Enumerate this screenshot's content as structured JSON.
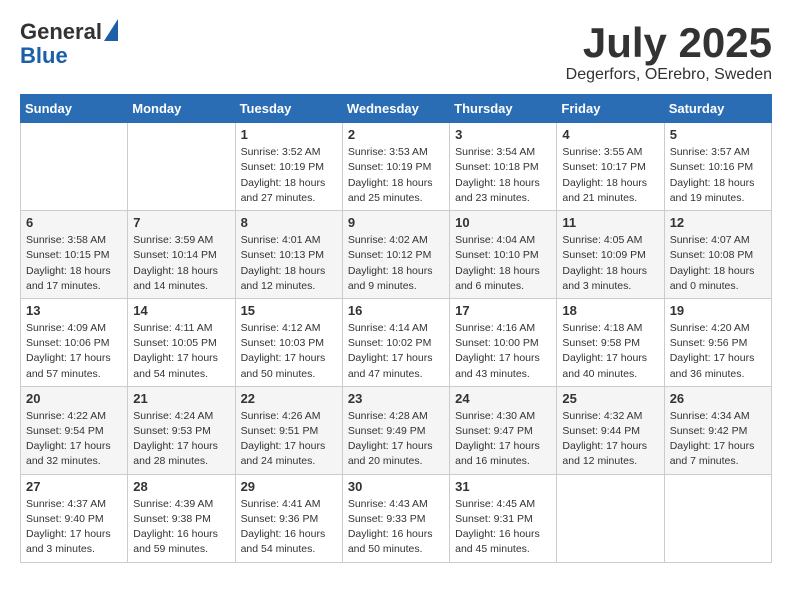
{
  "header": {
    "logo_line1": "General",
    "logo_line2": "Blue",
    "month_title": "July 2025",
    "location": "Degerfors, OErebro, Sweden"
  },
  "days_of_week": [
    "Sunday",
    "Monday",
    "Tuesday",
    "Wednesday",
    "Thursday",
    "Friday",
    "Saturday"
  ],
  "weeks": [
    [
      {
        "num": "",
        "info": ""
      },
      {
        "num": "",
        "info": ""
      },
      {
        "num": "1",
        "info": "Sunrise: 3:52 AM\nSunset: 10:19 PM\nDaylight: 18 hours and 27 minutes."
      },
      {
        "num": "2",
        "info": "Sunrise: 3:53 AM\nSunset: 10:19 PM\nDaylight: 18 hours and 25 minutes."
      },
      {
        "num": "3",
        "info": "Sunrise: 3:54 AM\nSunset: 10:18 PM\nDaylight: 18 hours and 23 minutes."
      },
      {
        "num": "4",
        "info": "Sunrise: 3:55 AM\nSunset: 10:17 PM\nDaylight: 18 hours and 21 minutes."
      },
      {
        "num": "5",
        "info": "Sunrise: 3:57 AM\nSunset: 10:16 PM\nDaylight: 18 hours and 19 minutes."
      }
    ],
    [
      {
        "num": "6",
        "info": "Sunrise: 3:58 AM\nSunset: 10:15 PM\nDaylight: 18 hours and 17 minutes."
      },
      {
        "num": "7",
        "info": "Sunrise: 3:59 AM\nSunset: 10:14 PM\nDaylight: 18 hours and 14 minutes."
      },
      {
        "num": "8",
        "info": "Sunrise: 4:01 AM\nSunset: 10:13 PM\nDaylight: 18 hours and 12 minutes."
      },
      {
        "num": "9",
        "info": "Sunrise: 4:02 AM\nSunset: 10:12 PM\nDaylight: 18 hours and 9 minutes."
      },
      {
        "num": "10",
        "info": "Sunrise: 4:04 AM\nSunset: 10:10 PM\nDaylight: 18 hours and 6 minutes."
      },
      {
        "num": "11",
        "info": "Sunrise: 4:05 AM\nSunset: 10:09 PM\nDaylight: 18 hours and 3 minutes."
      },
      {
        "num": "12",
        "info": "Sunrise: 4:07 AM\nSunset: 10:08 PM\nDaylight: 18 hours and 0 minutes."
      }
    ],
    [
      {
        "num": "13",
        "info": "Sunrise: 4:09 AM\nSunset: 10:06 PM\nDaylight: 17 hours and 57 minutes."
      },
      {
        "num": "14",
        "info": "Sunrise: 4:11 AM\nSunset: 10:05 PM\nDaylight: 17 hours and 54 minutes."
      },
      {
        "num": "15",
        "info": "Sunrise: 4:12 AM\nSunset: 10:03 PM\nDaylight: 17 hours and 50 minutes."
      },
      {
        "num": "16",
        "info": "Sunrise: 4:14 AM\nSunset: 10:02 PM\nDaylight: 17 hours and 47 minutes."
      },
      {
        "num": "17",
        "info": "Sunrise: 4:16 AM\nSunset: 10:00 PM\nDaylight: 17 hours and 43 minutes."
      },
      {
        "num": "18",
        "info": "Sunrise: 4:18 AM\nSunset: 9:58 PM\nDaylight: 17 hours and 40 minutes."
      },
      {
        "num": "19",
        "info": "Sunrise: 4:20 AM\nSunset: 9:56 PM\nDaylight: 17 hours and 36 minutes."
      }
    ],
    [
      {
        "num": "20",
        "info": "Sunrise: 4:22 AM\nSunset: 9:54 PM\nDaylight: 17 hours and 32 minutes."
      },
      {
        "num": "21",
        "info": "Sunrise: 4:24 AM\nSunset: 9:53 PM\nDaylight: 17 hours and 28 minutes."
      },
      {
        "num": "22",
        "info": "Sunrise: 4:26 AM\nSunset: 9:51 PM\nDaylight: 17 hours and 24 minutes."
      },
      {
        "num": "23",
        "info": "Sunrise: 4:28 AM\nSunset: 9:49 PM\nDaylight: 17 hours and 20 minutes."
      },
      {
        "num": "24",
        "info": "Sunrise: 4:30 AM\nSunset: 9:47 PM\nDaylight: 17 hours and 16 minutes."
      },
      {
        "num": "25",
        "info": "Sunrise: 4:32 AM\nSunset: 9:44 PM\nDaylight: 17 hours and 12 minutes."
      },
      {
        "num": "26",
        "info": "Sunrise: 4:34 AM\nSunset: 9:42 PM\nDaylight: 17 hours and 7 minutes."
      }
    ],
    [
      {
        "num": "27",
        "info": "Sunrise: 4:37 AM\nSunset: 9:40 PM\nDaylight: 17 hours and 3 minutes."
      },
      {
        "num": "28",
        "info": "Sunrise: 4:39 AM\nSunset: 9:38 PM\nDaylight: 16 hours and 59 minutes."
      },
      {
        "num": "29",
        "info": "Sunrise: 4:41 AM\nSunset: 9:36 PM\nDaylight: 16 hours and 54 minutes."
      },
      {
        "num": "30",
        "info": "Sunrise: 4:43 AM\nSunset: 9:33 PM\nDaylight: 16 hours and 50 minutes."
      },
      {
        "num": "31",
        "info": "Sunrise: 4:45 AM\nSunset: 9:31 PM\nDaylight: 16 hours and 45 minutes."
      },
      {
        "num": "",
        "info": ""
      },
      {
        "num": "",
        "info": ""
      }
    ]
  ]
}
